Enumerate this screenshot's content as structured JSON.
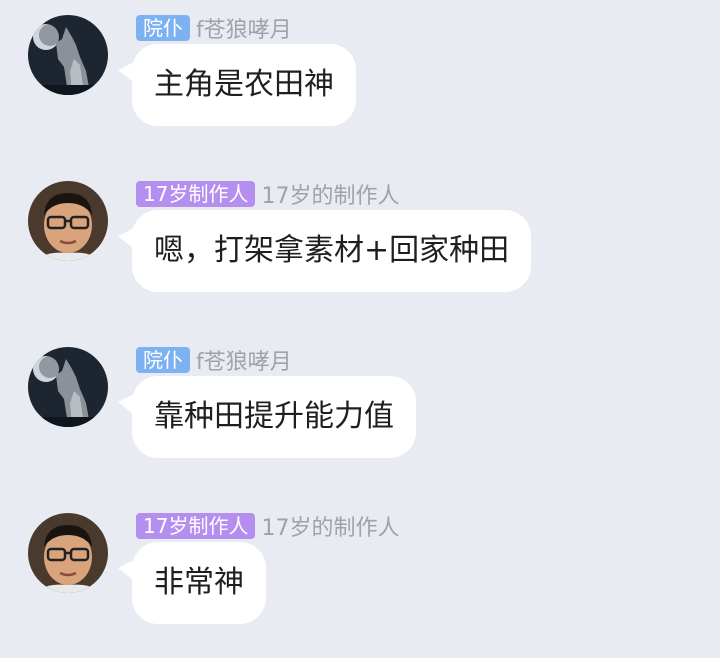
{
  "messages": [
    {
      "badge": "院仆",
      "badge_color": "#7cb2f2",
      "name": "f苍狼哮月",
      "avatar": "wolf-avatar-icon",
      "text": "主角是农田神"
    },
    {
      "badge": "17岁制作人",
      "badge_color": "#b48ff0",
      "name": "17岁的制作人",
      "avatar": "person-avatar-icon",
      "text": "嗯，打架拿素材+回家种田"
    },
    {
      "badge": "院仆",
      "badge_color": "#7cb2f2",
      "name": "f苍狼哮月",
      "avatar": "wolf-avatar-icon",
      "text": "靠种田提升能力值"
    },
    {
      "badge": "17岁制作人",
      "badge_color": "#b48ff0",
      "name": "17岁的制作人",
      "avatar": "person-avatar-icon",
      "text": "非常神"
    }
  ]
}
